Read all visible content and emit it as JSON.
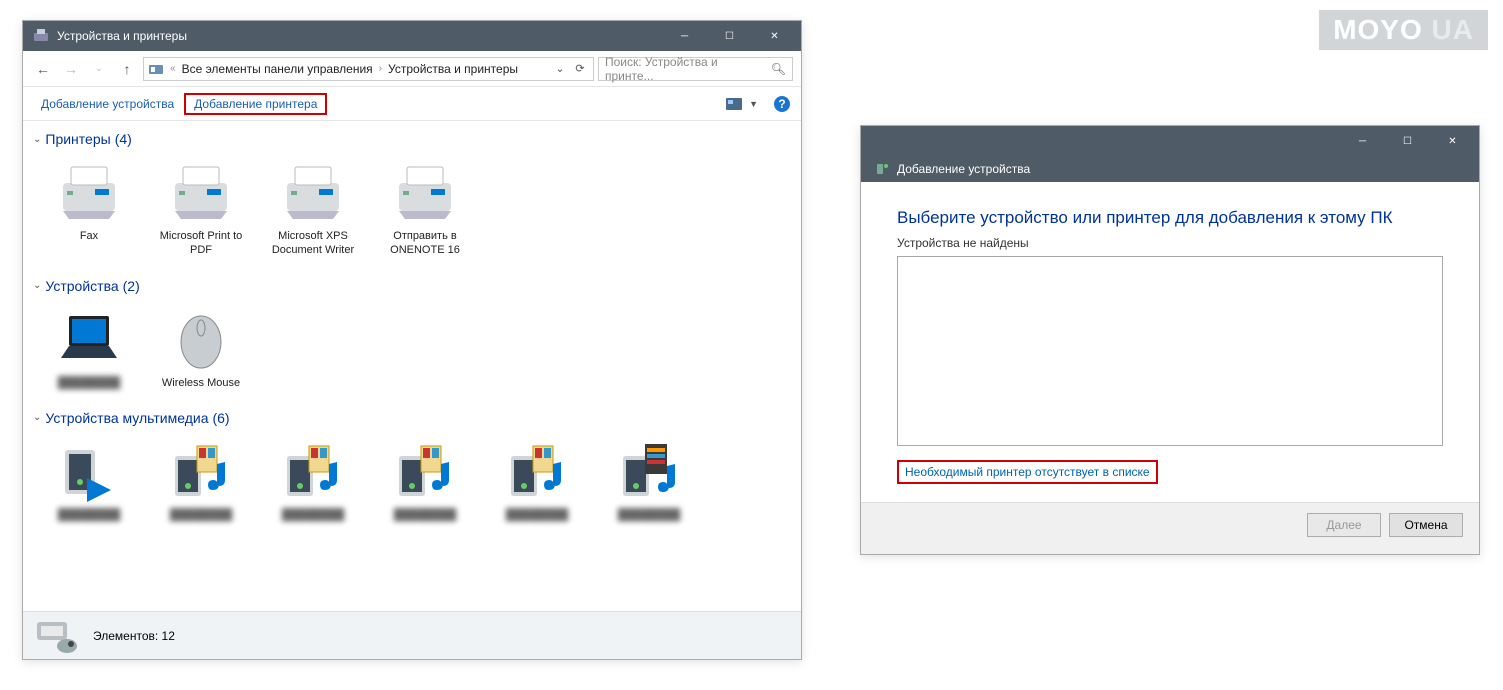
{
  "watermark": {
    "text1": "MOYO",
    "text2": "UA"
  },
  "win1": {
    "title": "Устройства и принтеры",
    "breadcrumb": {
      "seg1": "Все элементы панели управления",
      "seg2": "Устройства и принтеры"
    },
    "search_placeholder": "Поиск: Устройства и принте...",
    "toolbar": {
      "add_device": "Добавление устройства",
      "add_printer": "Добавление принтера"
    },
    "groups": {
      "printers": {
        "name": "Принтеры",
        "count": "(4)"
      },
      "devices": {
        "name": "Устройства",
        "count": "(2)"
      },
      "multimedia": {
        "name": "Устройства мультимедиа",
        "count": "(6)"
      }
    },
    "printers": [
      {
        "label": "Fax"
      },
      {
        "label": "Microsoft Print to PDF"
      },
      {
        "label": "Microsoft XPS Document Writer"
      },
      {
        "label": "Отправить в ONENOTE 16"
      }
    ],
    "devices": [
      {
        "label": ""
      },
      {
        "label": "Wireless Mouse"
      }
    ],
    "status": "Элементов: 12"
  },
  "win2": {
    "subtitle": "Добавление устройства",
    "heading": "Выберите устройство или принтер для добавления к этому ПК",
    "msg": "Устройства не найдены",
    "link": "Необходимый принтер отсутствует в списке",
    "btn_next": "Далее",
    "btn_cancel": "Отмена"
  }
}
